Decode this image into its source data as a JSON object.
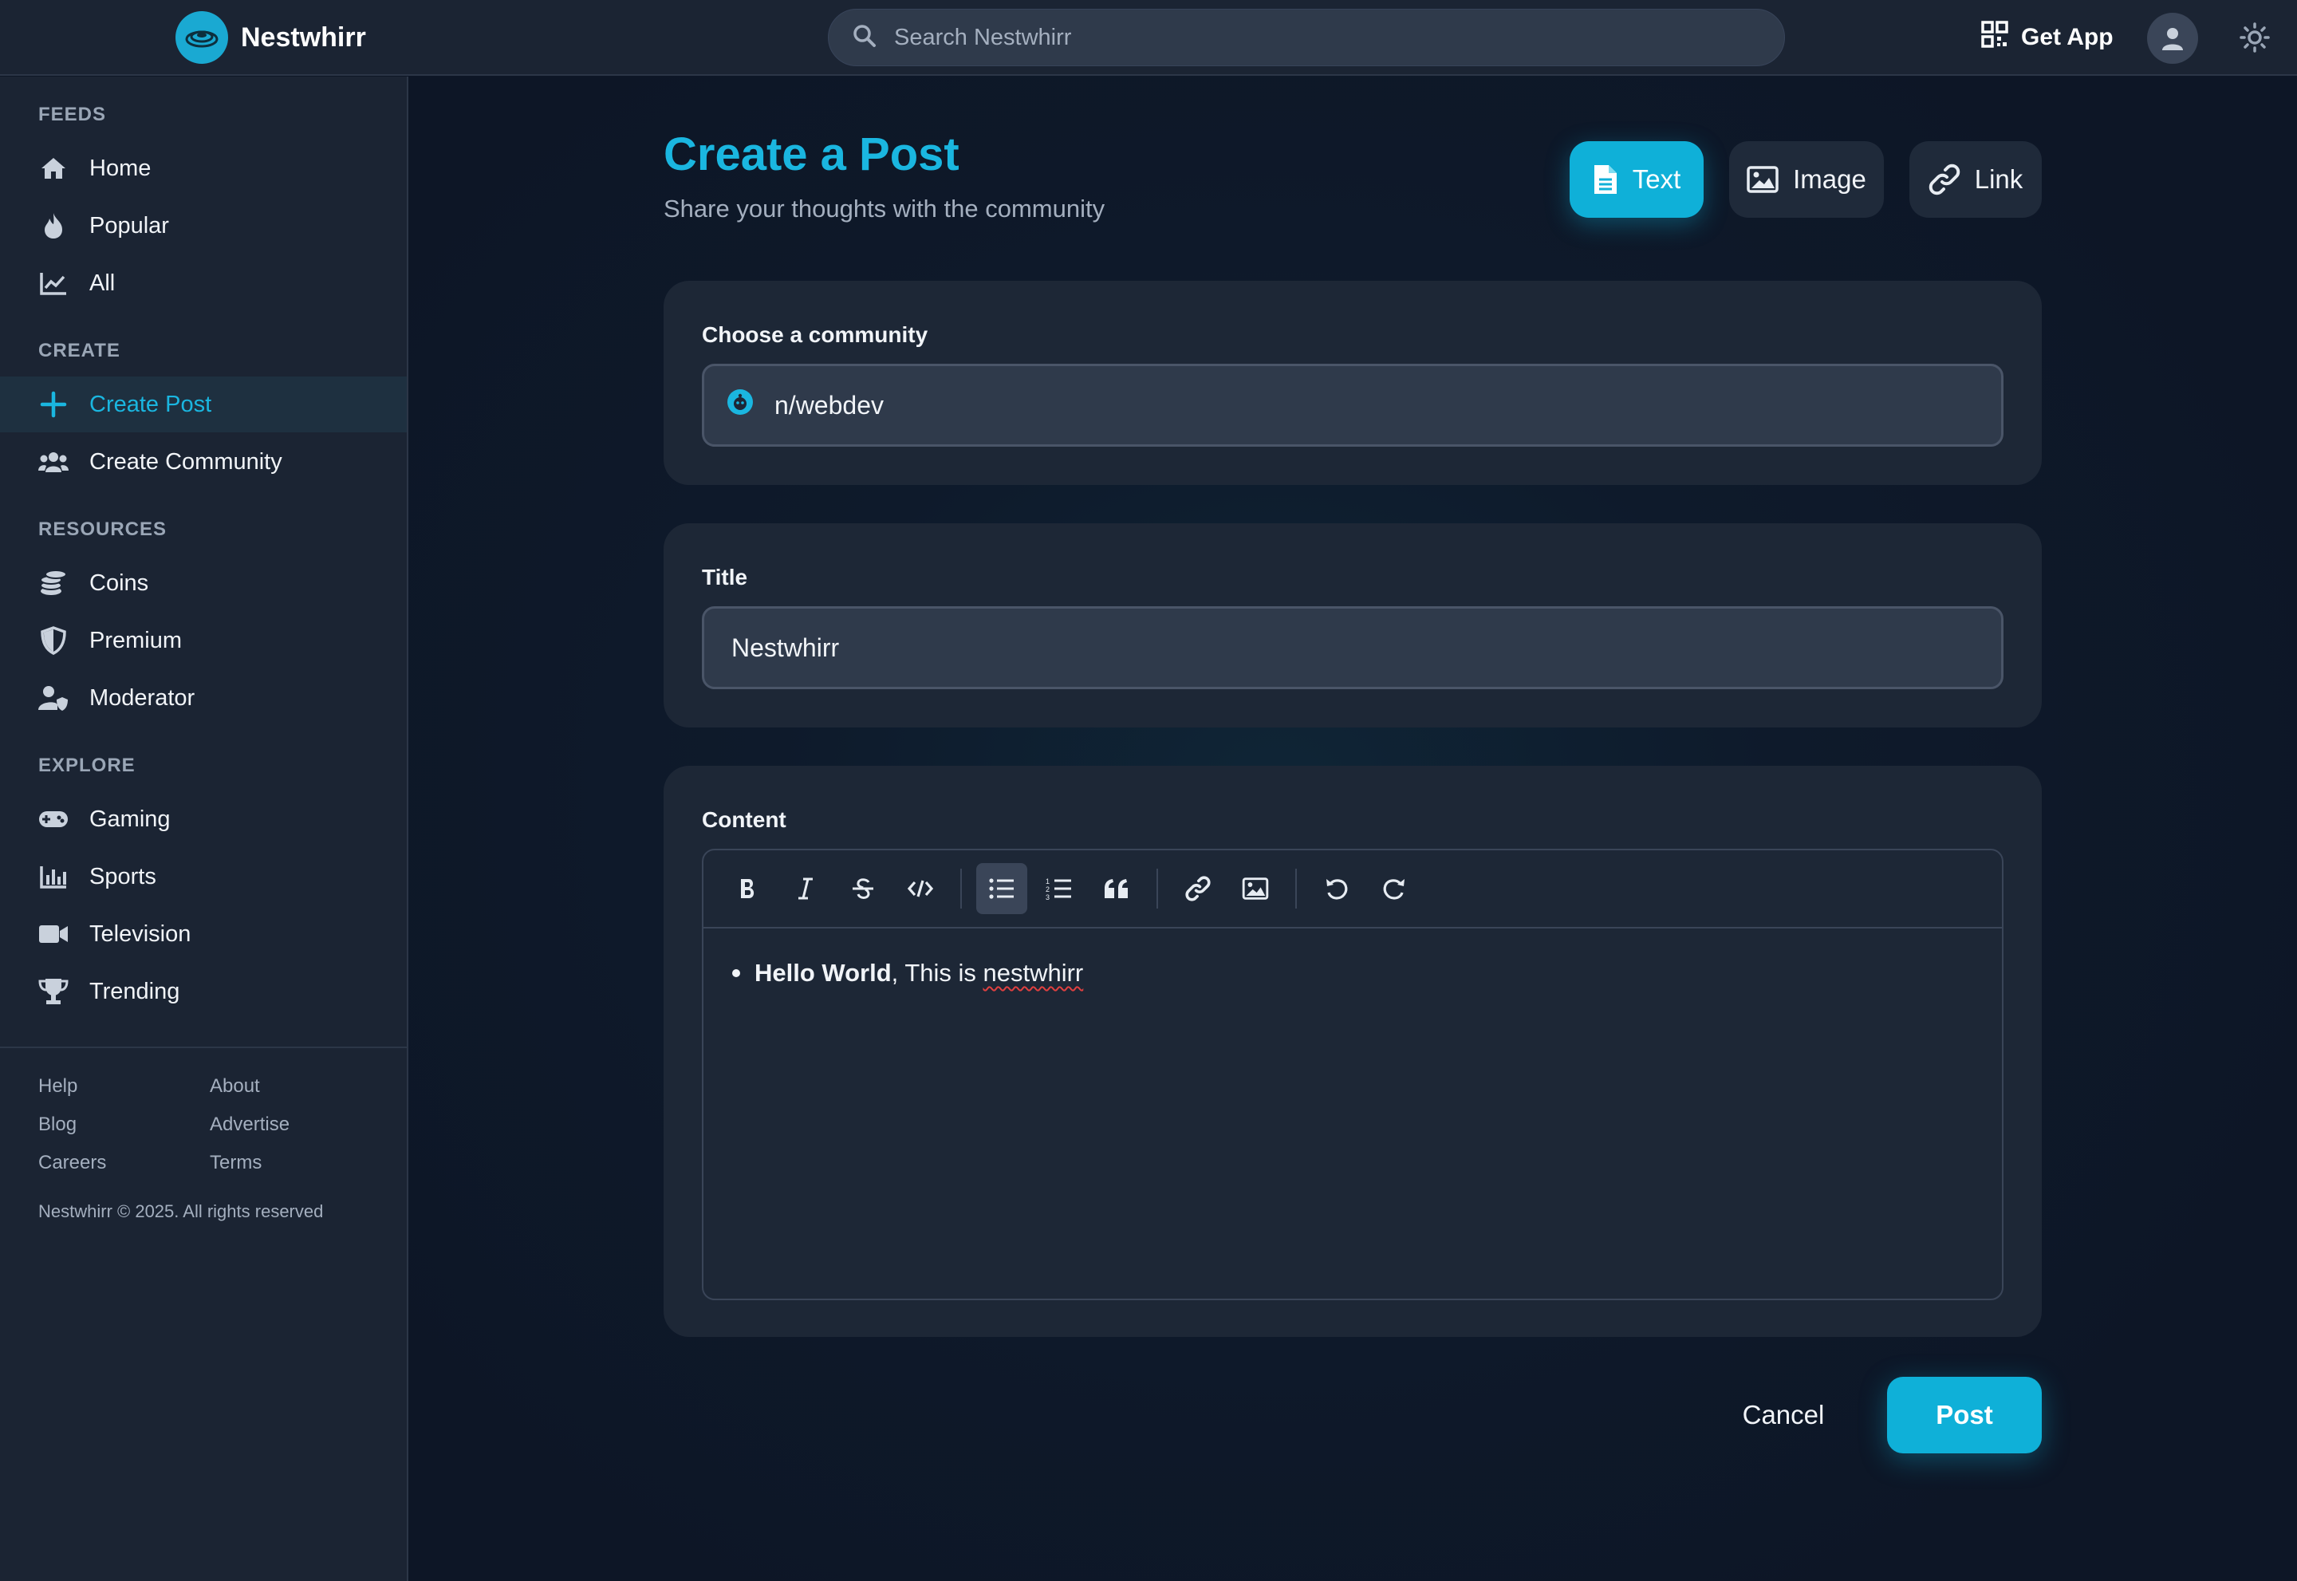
{
  "header": {
    "brand_name": "Nestwhirr",
    "search_placeholder": "Search Nestwhirr",
    "get_app_label": "Get App"
  },
  "sidebar": {
    "sections": {
      "feeds": "FEEDS",
      "create": "CREATE",
      "resources": "RESOURCES",
      "explore": "EXPLORE"
    },
    "feeds": [
      {
        "label": "Home",
        "icon": "home-icon"
      },
      {
        "label": "Popular",
        "icon": "flame-icon"
      },
      {
        "label": "All",
        "icon": "chart-line-icon"
      }
    ],
    "create": [
      {
        "label": "Create Post",
        "icon": "plus-icon",
        "active": true
      },
      {
        "label": "Create Community",
        "icon": "users-icon"
      }
    ],
    "resources": [
      {
        "label": "Coins",
        "icon": "coins-icon"
      },
      {
        "label": "Premium",
        "icon": "shield-icon"
      },
      {
        "label": "Moderator",
        "icon": "user-shield-icon"
      }
    ],
    "explore": [
      {
        "label": "Gaming",
        "icon": "gamepad-icon"
      },
      {
        "label": "Sports",
        "icon": "bar-chart-icon"
      },
      {
        "label": "Television",
        "icon": "video-icon"
      },
      {
        "label": "Trending",
        "icon": "trophy-icon"
      }
    ],
    "footer_links": [
      "Help",
      "About",
      "Blog",
      "Advertise",
      "Careers",
      "Terms"
    ],
    "copyright": "Nestwhirr © 2025. All rights reserved"
  },
  "main": {
    "title": "Create a Post",
    "subtitle": "Share your thoughts with the community",
    "post_types": [
      {
        "label": "Text",
        "icon": "file-text-icon",
        "active": true
      },
      {
        "label": "Image",
        "icon": "image-icon",
        "active": false
      },
      {
        "label": "Link",
        "icon": "link-icon",
        "active": false
      }
    ],
    "community": {
      "label": "Choose a community",
      "value": "n/webdev"
    },
    "title_field": {
      "label": "Title",
      "value": "Nestwhirr"
    },
    "content": {
      "label": "Content",
      "toolbar": [
        "bold-icon",
        "italic-icon",
        "strikethrough-icon",
        "code-icon",
        "bullet-list-icon",
        "numbered-list-icon",
        "quote-icon",
        "link-icon",
        "image-icon",
        "undo-icon",
        "redo-icon"
      ],
      "bold_text": "Hello World",
      "text_middle": ", This is ",
      "misspelled_word": "nestwhirr"
    },
    "cancel_label": "Cancel",
    "post_label": "Post"
  },
  "colors": {
    "accent": "#0fb0d8",
    "accent_text": "#1ab6e0",
    "panel": "#1d2736",
    "sidebar": "#1b2433"
  }
}
